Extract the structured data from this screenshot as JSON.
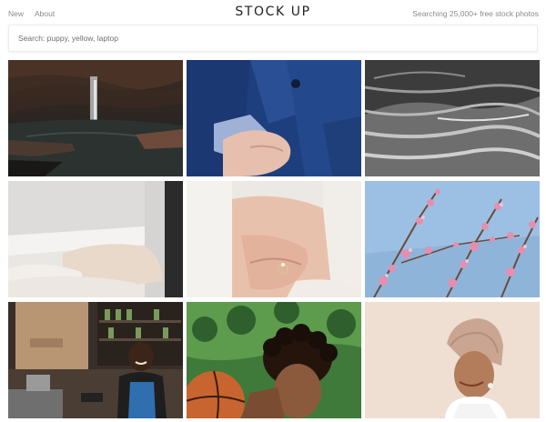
{
  "header": {
    "nav": [
      {
        "label": "New"
      },
      {
        "label": "About"
      }
    ],
    "brand": "STOCK UP",
    "count_text": "Searching 25,000+ free stock photos"
  },
  "search": {
    "placeholder": "Search: puppy, yellow, laptop",
    "value": ""
  },
  "photos": [
    {
      "subject": "waterfall-cave"
    },
    {
      "subject": "suit-hands"
    },
    {
      "subject": "textured-water"
    },
    {
      "subject": "bed-pillows"
    },
    {
      "subject": "engagement-ring-hands"
    },
    {
      "subject": "pink-blossoms"
    },
    {
      "subject": "barista-cafe"
    },
    {
      "subject": "basketball-player"
    },
    {
      "subject": "woman-headscarf"
    }
  ],
  "colors": {
    "nav_text": "#8a8a8a",
    "brand_text": "#222222",
    "background": "#ffffff"
  }
}
